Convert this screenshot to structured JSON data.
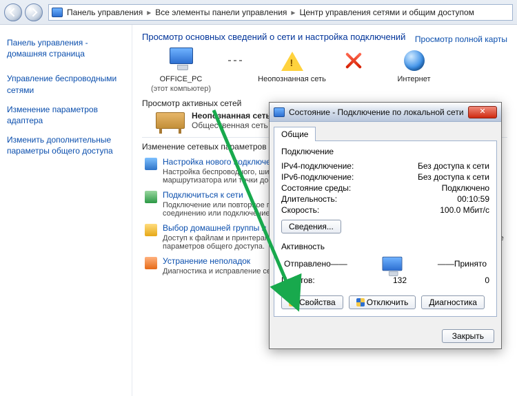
{
  "toolbar": {
    "crumbs": [
      "Панель управления",
      "Все элементы панели управления",
      "Центр управления сетями и общим доступом"
    ]
  },
  "sidebar": {
    "title1": "Панель управления -",
    "title2": "домашняя страница",
    "items": [
      "Управление беспроводными сетями",
      "Изменение параметров адаптера",
      "Изменить дополнительные параметры общего доступа"
    ]
  },
  "main": {
    "heading": "Просмотр основных сведений о сети и настройка подключений",
    "full_map": "Просмотр полной карты",
    "nodes": {
      "pc_name": "OFFICE_PC",
      "pc_sub": "(этот компьютер)",
      "unknown": "Неопознанная сеть",
      "internet": "Интернет"
    },
    "active_networks_label": "Просмотр активных сетей",
    "network_name": "Неопознанная сеть",
    "network_type": "Общественная сеть",
    "params_label": "Изменение сетевых параметров",
    "opts": [
      {
        "title": "Настройка нового подключения",
        "desc": "Настройка беспроводного, широкополосного, модемного, прямого или же настройка маршрутизатора или точки доступа."
      },
      {
        "title": "Подключиться к сети",
        "desc": "Подключение или повторное подключение к беспроводному, проводному, модемному сетевому соединению или подключение к VPN."
      },
      {
        "title": "Выбор домашней группы и параметров общего доступа",
        "desc": "Доступ к файлам и принтерам, расположенным на других сетевых компьютерах, или изменение параметров общего доступа."
      },
      {
        "title": "Устранение неполадок",
        "desc": "Диагностика и исправление сетевых проблем или получение сведений об исправлении."
      }
    ]
  },
  "dialog": {
    "title": "Состояние - Подключение по локальной сети",
    "tab": "Общие",
    "group_conn": "Подключение",
    "rows": {
      "ipv4_l": "IPv4-подключение:",
      "ipv4_v": "Без доступа к сети",
      "ipv6_l": "IPv6-подключение:",
      "ipv6_v": "Без доступа к сети",
      "media_l": "Состояние среды:",
      "media_v": "Подключено",
      "dur_l": "Длительность:",
      "dur_v": "00:10:59",
      "spd_l": "Скорость:",
      "spd_v": "100.0 Мбит/с"
    },
    "details_btn": "Сведения...",
    "group_act": "Активность",
    "sent": "Отправлено",
    "recv": "Принято",
    "pkt_l": "Пакетов:",
    "pkt_sent": "132",
    "pkt_recv": "0",
    "btn_props": "Свойства",
    "btn_disable": "Отключить",
    "btn_diag": "Диагностика",
    "btn_close": "Закрыть"
  }
}
